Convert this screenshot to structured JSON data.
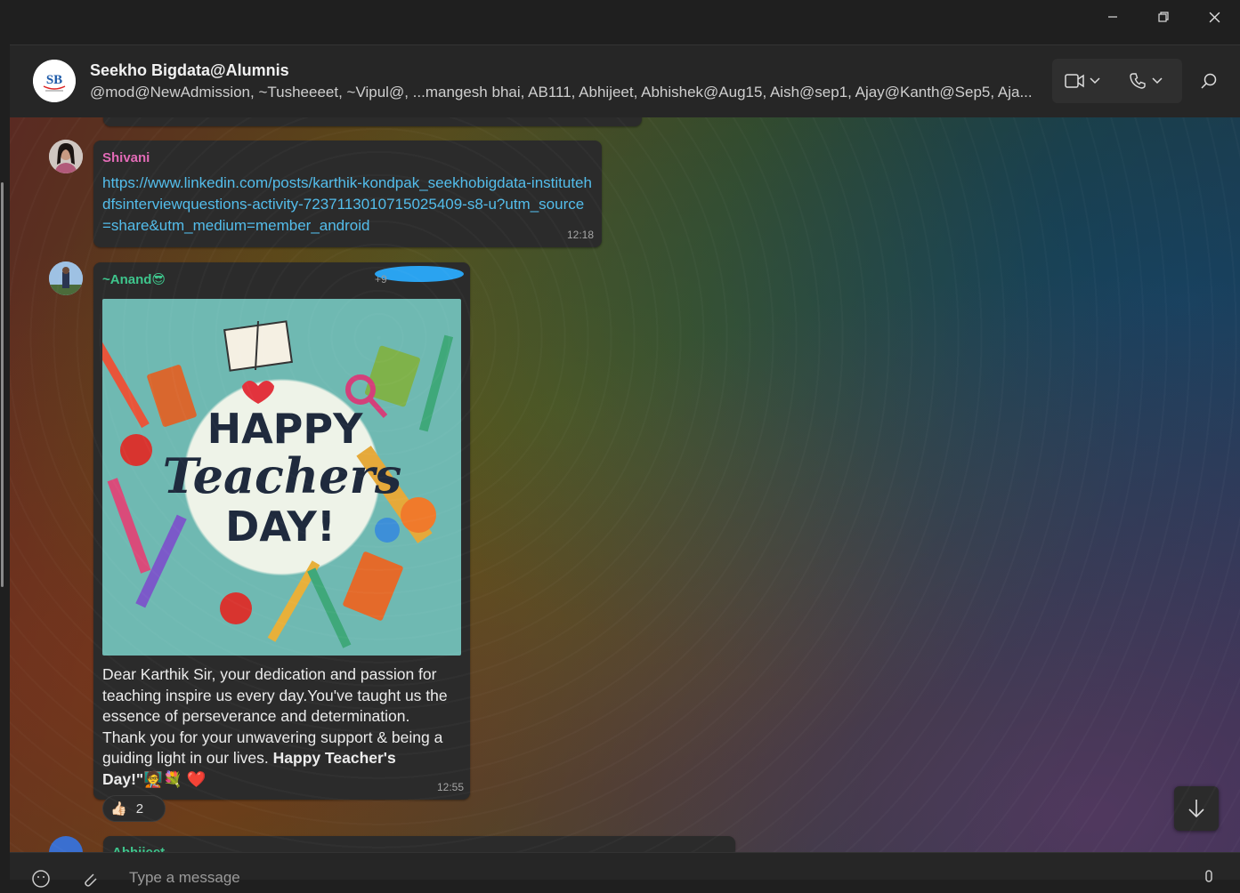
{
  "window": {
    "controls": [
      "minimize-icon",
      "restore-icon",
      "close-icon"
    ]
  },
  "header": {
    "title": "Seekho Bigdata@Alumnis",
    "members": "@mod@NewAdmission, ~Tusheeeet, ~Vipul@, ...mangesh bhai, AB111, Abhijeet, Abhishek@Aug15, Aish@sep1, Ajay@Kanth@Sep5, Aja...",
    "avatar_text": "SB",
    "icons": [
      "video-call-icon",
      "chevron-down-icon",
      "voice-call-icon",
      "chevron-down-icon",
      "search-icon"
    ]
  },
  "messages": [
    {
      "sender": "Shivani",
      "sender_color": "#e26ab6",
      "link": "https://www.linkedin.com/posts/karthik-kondpak_seekhobigdata-institutehdfsinterviewquestions-activity-7237113010715025409-s8-u?utm_source=share&utm_medium=member_android",
      "time": "12:18"
    },
    {
      "sender": "~Anand😎",
      "sender_color": "#3ec58c",
      "phone_fragment": "+9",
      "image": {
        "line1": "HAPPY",
        "line2": "Teachers",
        "line3": "DAY!"
      },
      "text_normal": "Dear Karthik Sir, your dedication and passion for teaching inspire us every day.You've taught us the essence of perseverance and determination. Thank you for your unwavering support &  being a guiding light in our lives. ",
      "text_bold": "Happy Teacher's Day!\"",
      "text_emoji": "🧑‍🏫💐 ❤️",
      "time": "12:55",
      "reaction_emoji": "👍🏻",
      "reaction_count": "2"
    },
    {
      "sender": "Abhijeet",
      "sender_color": "#3ec58c"
    }
  ],
  "composer": {
    "placeholder": "Type a message"
  },
  "colors": {
    "link": "#53bdeb",
    "bubble": "#2b2b2b",
    "header": "#262626"
  }
}
